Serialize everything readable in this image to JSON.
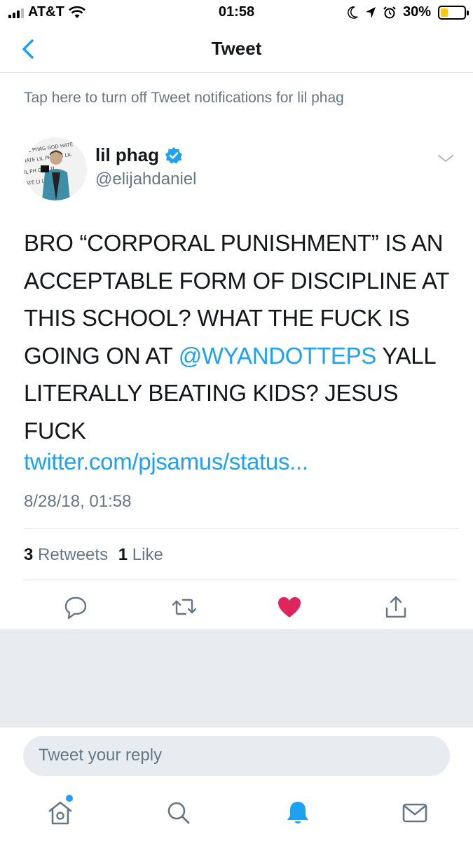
{
  "status_bar": {
    "carrier": "AT&T",
    "time": "01:58",
    "battery": "30%",
    "battery_level": 0.3
  },
  "nav": {
    "title": "Tweet"
  },
  "notification_text": "Tap here to turn off Tweet notifications for lil phag",
  "tweet": {
    "author_name": "lil phag",
    "author_handle": "@elijahdaniel",
    "text_before_mention": "BRO “CORPORAL PUNISHMENT” IS AN ACCEPTABLE FORM OF DISCIPLINE AT THIS SCHOOL? WHAT THE FUCK IS GOING ON AT ",
    "mention": "@WYANDOTTEPS",
    "text_after_mention": " YALL LITERALLY BEATING KIDS? JESUS FUCK",
    "link": "twitter.com/pjsamus/status...",
    "timestamp": "8/28/18, 01:58",
    "retweet_count": "3",
    "retweets_label": "Retweets",
    "like_count": "1",
    "likes_label": "Like"
  },
  "colors": {
    "accent": "#1da1f2",
    "like": "#e0245e",
    "secondary_text": "#657786"
  },
  "reply": {
    "placeholder": "Tweet your reply"
  },
  "tabbar": [
    "home-icon",
    "search-icon",
    "notifications-icon",
    "messages-icon"
  ]
}
